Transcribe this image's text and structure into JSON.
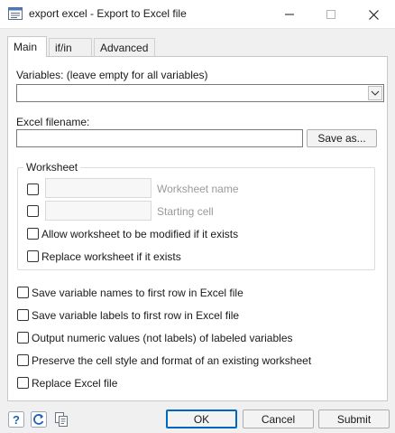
{
  "window": {
    "title": "export excel - Export to Excel file"
  },
  "tabs": [
    {
      "label": "Main",
      "active": true
    },
    {
      "label": "if/in",
      "active": false
    },
    {
      "label": "Advanced",
      "active": false
    }
  ],
  "main": {
    "variables_label": "Variables: (leave empty for all variables)",
    "variables_value": "",
    "filename_label": "Excel filename:",
    "filename_value": "",
    "save_as_label": "Save as...",
    "worksheet": {
      "group_label": "Worksheet",
      "name_label": "Worksheet name",
      "start_label": "Starting cell",
      "allow_modify_label": "Allow worksheet to be modified if it exists",
      "replace_label": "Replace worksheet if it exists"
    },
    "options": [
      "Save variable names to first row in Excel file",
      "Save variable labels to first row in Excel file",
      "Output numeric values (not labels) of labeled variables",
      "Preserve the cell style and format of an existing worksheet",
      "Replace Excel file"
    ]
  },
  "footer": {
    "ok_label": "OK",
    "cancel_label": "Cancel",
    "submit_label": "Submit",
    "icons": [
      "help-icon",
      "reset-icon",
      "copy-command-icon"
    ]
  },
  "colors": {
    "accent": "#0067c0",
    "help_icon": "#1e63b5",
    "reset_icon": "#1e63b5"
  }
}
